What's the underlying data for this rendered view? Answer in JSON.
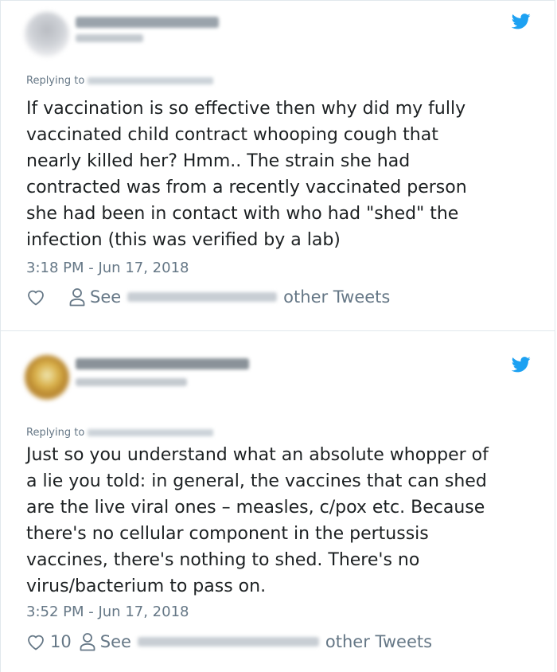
{
  "colors": {
    "twitter_blue": "#1da1f2",
    "meta_gray": "#657786",
    "text_dark": "#1c2022",
    "border": "#e1e8ed"
  },
  "icons": {
    "brand": "twitter-bird-icon",
    "like": "heart-outline-icon",
    "profile": "person-outline-icon"
  },
  "tweets": [
    {
      "replying_label": "Replying to",
      "text": "If vaccination is so effective then why did my fully\nvaccinated child contract whooping cough that\nnearly killed her? Hmm.. The strain she had\ncontracted was from a recently vaccinated person\nshe had been in contact with who had \"shed\" the\ninfection (this was verified by a lab)",
      "timestamp": "3:18 PM - Jun 17, 2018",
      "like_count": "",
      "see_label": "See",
      "other_tweets_label": "other Tweets"
    },
    {
      "replying_label": "Replying to",
      "text": "Just so you understand what an absolute whopper of\na lie you told: in general, the vaccines that can shed\nare the live viral ones – measles, c/pox etc. Because\nthere's no cellular component in the pertussis\nvaccines, there's nothing to shed. There's no\nvirus/bacterium to pass on.",
      "timestamp": "3:52 PM - Jun 17, 2018",
      "like_count": "10",
      "see_label": "See",
      "other_tweets_label": "other Tweets"
    }
  ]
}
